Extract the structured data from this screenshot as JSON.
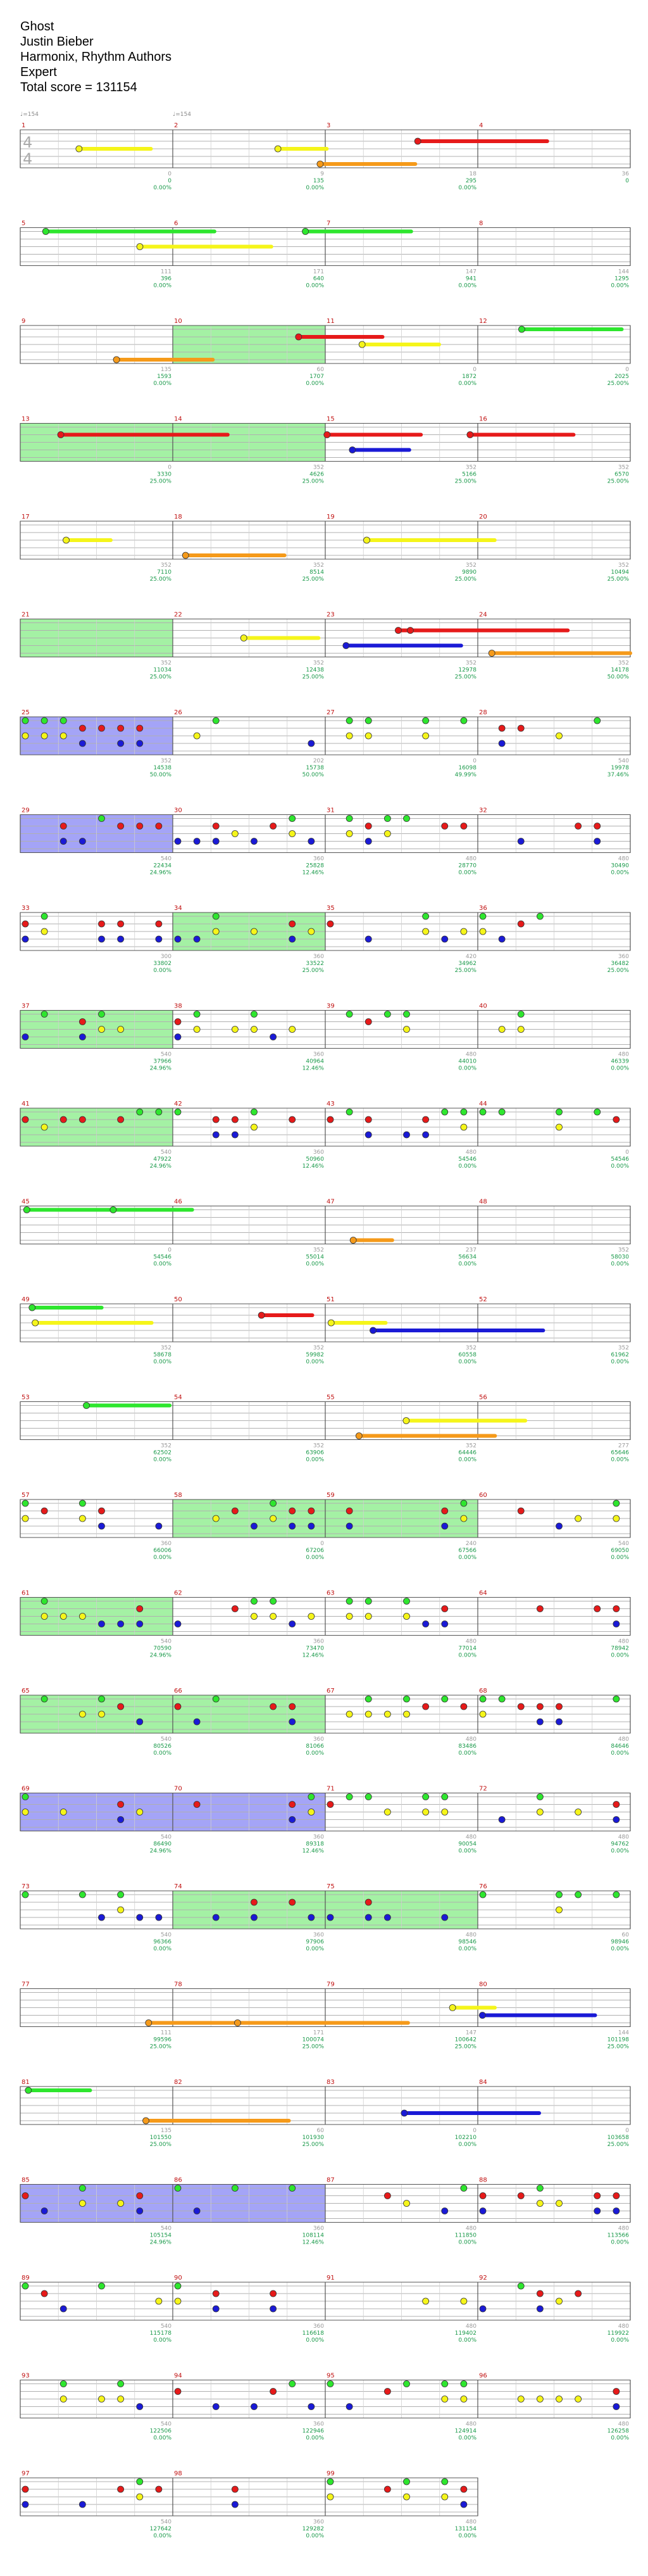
{
  "song": {
    "title": "Ghost",
    "artist": "Justin Bieber",
    "charter": "Harmonix, Rhythm Authors",
    "difficulty": "Expert",
    "total_score_label": "Total score = 131154"
  },
  "chart_data": {
    "type": "note-chart",
    "time_signature": {
      "numerator": "4",
      "denominator": "4"
    },
    "tempo_markers": [
      {
        "measure": 1,
        "label": "♩=154"
      },
      {
        "measure": 2,
        "label": "♩=154"
      }
    ],
    "lane_colors": {
      "green": "#2ee62e",
      "red": "#e61a1a",
      "yellow": "#f5f51a",
      "blue": "#1a1ad6",
      "orange": "#f59a1a"
    },
    "zone_colors": {
      "solo": "#5a5af0",
      "overdrive": "#5ae65a"
    },
    "score_color": "#1a9a4a",
    "count_color": "#9a9a9a",
    "rows": [
      {
        "measures": [
          1,
          2,
          3,
          4
        ],
        "blocks": [
          {
            "count": "0",
            "score": "0",
            "mult": "0.00%"
          },
          {
            "count": "9",
            "score": "135",
            "mult": "0.00%"
          },
          {
            "count": "18",
            "score": "295",
            "mult": "0.00%"
          },
          {
            "count": "36",
            "score": "0",
            "mult": ""
          }
        ]
      },
      {
        "measures": [
          5,
          6,
          7,
          8
        ],
        "blocks": [
          {
            "count": "111",
            "score": "396",
            "mult": "0.00%"
          },
          {
            "count": "171",
            "score": "640",
            "mult": "0.00%"
          },
          {
            "count": "147",
            "score": "941",
            "mult": "0.00%"
          },
          {
            "count": "144",
            "score": "1295",
            "mult": "0.00%"
          }
        ]
      },
      {
        "measures": [
          9,
          10,
          11,
          12
        ],
        "blocks": [
          {
            "count": "135",
            "score": "1593",
            "mult": "0.00%"
          },
          {
            "count": "60",
            "score": "1707",
            "mult": "0.00%"
          },
          {
            "count": "0",
            "score": "1872",
            "mult": "0.00%"
          },
          {
            "count": "0",
            "score": "2025",
            "mult": "25.00%"
          }
        ]
      },
      {
        "measures": [
          13,
          14,
          15,
          16
        ],
        "blocks": [
          {
            "count": "0",
            "score": "3330",
            "mult": "25.00%"
          },
          {
            "count": "352",
            "score": "4626",
            "mult": "25.00%"
          },
          {
            "count": "352",
            "score": "5166",
            "mult": "25.00%"
          },
          {
            "count": "352",
            "score": "6570",
            "mult": "25.00%"
          }
        ]
      },
      {
        "measures": [
          17,
          18,
          19,
          20
        ],
        "blocks": [
          {
            "count": "352",
            "score": "7110",
            "mult": "25.00%"
          },
          {
            "count": "352",
            "score": "8514",
            "mult": "25.00%"
          },
          {
            "count": "352",
            "score": "9890",
            "mult": "25.00%"
          },
          {
            "count": "352",
            "score": "10494",
            "mult": "25.00%"
          }
        ]
      },
      {
        "measures": [
          21,
          22,
          23,
          24
        ],
        "blocks": [
          {
            "count": "352",
            "score": "11034",
            "mult": "25.00%"
          },
          {
            "count": "352",
            "score": "12438",
            "mult": "25.00%"
          },
          {
            "count": "352",
            "score": "12978",
            "mult": "25.00%"
          },
          {
            "count": "352",
            "score": "14178",
            "mult": "50.00%"
          }
        ]
      },
      {
        "measures": [
          25,
          26,
          27,
          28
        ],
        "blocks": [
          {
            "count": "352",
            "score": "14538",
            "mult": "50.00%"
          },
          {
            "count": "202",
            "score": "15738",
            "mult": "50.00%"
          },
          {
            "count": "0",
            "score": "16098",
            "mult": "49.99%"
          },
          {
            "count": "540",
            "score": "19978",
            "mult": "37.46%"
          }
        ]
      },
      {
        "measures": [
          29,
          30,
          31,
          32
        ],
        "blocks": [
          {
            "count": "540",
            "score": "22434",
            "mult": "24.96%"
          },
          {
            "count": "360",
            "score": "25828",
            "mult": "12.46%"
          },
          {
            "count": "480",
            "score": "28770",
            "mult": "0.00%"
          },
          {
            "count": "480",
            "score": "30490",
            "mult": "0.00%"
          }
        ]
      },
      {
        "measures": [
          33,
          34,
          35,
          36
        ],
        "blocks": [
          {
            "count": "300",
            "score": "33802",
            "mult": "0.00%"
          },
          {
            "count": "360",
            "score": "33522",
            "mult": "25.00%"
          },
          {
            "count": "420",
            "score": "34962",
            "mult": "25.00%"
          },
          {
            "count": "360",
            "score": "36482",
            "mult": "25.00%"
          }
        ]
      },
      {
        "measures": [
          37,
          38,
          39,
          40
        ],
        "blocks": [
          {
            "count": "540",
            "score": "37966",
            "mult": "24.96%"
          },
          {
            "count": "360",
            "score": "40964",
            "mult": "12.46%"
          },
          {
            "count": "480",
            "score": "44010",
            "mult": "0.00%"
          },
          {
            "count": "480",
            "score": "46339",
            "mult": "0.00%"
          }
        ]
      },
      {
        "measures": [
          41,
          42,
          43,
          44
        ],
        "blocks": [
          {
            "count": "540",
            "score": "47922",
            "mult": "24.96%"
          },
          {
            "count": "360",
            "score": "50960",
            "mult": "12.46%"
          },
          {
            "count": "480",
            "score": "54546",
            "mult": "0.00%"
          },
          {
            "count": "0",
            "score": "54546",
            "mult": "0.00%"
          }
        ]
      },
      {
        "measures": [
          45,
          46,
          47,
          48
        ],
        "blocks": [
          {
            "count": "0",
            "score": "54546",
            "mult": "0.00%"
          },
          {
            "count": "352",
            "score": "55014",
            "mult": "0.00%"
          },
          {
            "count": "237",
            "score": "56634",
            "mult": "0.00%"
          },
          {
            "count": "352",
            "score": "58030",
            "mult": "0.00%"
          }
        ]
      },
      {
        "measures": [
          49,
          50,
          51,
          52
        ],
        "blocks": [
          {
            "count": "352",
            "score": "58678",
            "mult": "0.00%"
          },
          {
            "count": "352",
            "score": "59982",
            "mult": "0.00%"
          },
          {
            "count": "352",
            "score": "60558",
            "mult": "0.00%"
          },
          {
            "count": "352",
            "score": "61962",
            "mult": "0.00%"
          }
        ]
      },
      {
        "measures": [
          53,
          54,
          55,
          56
        ],
        "blocks": [
          {
            "count": "352",
            "score": "62502",
            "mult": "0.00%"
          },
          {
            "count": "352",
            "score": "63906",
            "mult": "0.00%"
          },
          {
            "count": "352",
            "score": "64446",
            "mult": "0.00%"
          },
          {
            "count": "277",
            "score": "65646",
            "mult": "0.00%"
          }
        ]
      },
      {
        "measures": [
          57,
          58,
          59,
          60
        ],
        "blocks": [
          {
            "count": "360",
            "score": "66006",
            "mult": "0.00%"
          },
          {
            "count": "0",
            "score": "67206",
            "mult": "0.00%"
          },
          {
            "count": "240",
            "score": "67566",
            "mult": "0.00%"
          },
          {
            "count": "540",
            "score": "69050",
            "mult": "0.00%"
          }
        ]
      },
      {
        "measures": [
          61,
          62,
          63,
          64
        ],
        "blocks": [
          {
            "count": "540",
            "score": "70590",
            "mult": "24.96%"
          },
          {
            "count": "360",
            "score": "73470",
            "mult": "12.46%"
          },
          {
            "count": "480",
            "score": "77014",
            "mult": "0.00%"
          },
          {
            "count": "480",
            "score": "78942",
            "mult": "0.00%"
          }
        ]
      },
      {
        "measures": [
          65,
          66,
          67,
          68
        ],
        "blocks": [
          {
            "count": "540",
            "score": "80526",
            "mult": "0.00%"
          },
          {
            "count": "360",
            "score": "81066",
            "mult": "0.00%"
          },
          {
            "count": "480",
            "score": "83486",
            "mult": "0.00%"
          },
          {
            "count": "480",
            "score": "84646",
            "mult": "0.00%"
          }
        ]
      },
      {
        "measures": [
          69,
          70,
          71,
          72
        ],
        "blocks": [
          {
            "count": "540",
            "score": "86490",
            "mult": "24.96%"
          },
          {
            "count": "360",
            "score": "89318",
            "mult": "12.46%"
          },
          {
            "count": "480",
            "score": "90054",
            "mult": "0.00%"
          },
          {
            "count": "480",
            "score": "94762",
            "mult": "0.00%"
          }
        ]
      },
      {
        "measures": [
          73,
          74,
          75,
          76
        ],
        "blocks": [
          {
            "count": "540",
            "score": "96366",
            "mult": "0.00%"
          },
          {
            "count": "360",
            "score": "97906",
            "mult": "0.00%"
          },
          {
            "count": "480",
            "score": "98546",
            "mult": "0.00%"
          },
          {
            "count": "60",
            "score": "98946",
            "mult": "0.00%"
          }
        ]
      },
      {
        "measures": [
          77,
          78,
          79,
          80
        ],
        "blocks": [
          {
            "count": "111",
            "score": "99596",
            "mult": "25.00%"
          },
          {
            "count": "171",
            "score": "100074",
            "mult": "25.00%"
          },
          {
            "count": "147",
            "score": "100642",
            "mult": "25.00%"
          },
          {
            "count": "144",
            "score": "101198",
            "mult": "25.00%"
          }
        ]
      },
      {
        "measures": [
          81,
          82,
          83,
          84
        ],
        "blocks": [
          {
            "count": "135",
            "score": "101550",
            "mult": "25.00%"
          },
          {
            "count": "60",
            "score": "101930",
            "mult": "25.00%"
          },
          {
            "count": "0",
            "score": "102210",
            "mult": "0.00%"
          },
          {
            "count": "0",
            "score": "103658",
            "mult": "25.00%"
          }
        ]
      },
      {
        "measures": [
          85,
          86,
          87,
          88
        ],
        "blocks": [
          {
            "count": "540",
            "score": "105154",
            "mult": "24.96%"
          },
          {
            "count": "360",
            "score": "108114",
            "mult": "12.46%"
          },
          {
            "count": "480",
            "score": "111850",
            "mult": "0.00%"
          },
          {
            "count": "480",
            "score": "113566",
            "mult": "0.00%"
          }
        ]
      },
      {
        "measures": [
          89,
          90,
          91,
          92
        ],
        "blocks": [
          {
            "count": "540",
            "score": "115178",
            "mult": "0.00%"
          },
          {
            "count": "360",
            "score": "116618",
            "mult": "0.00%"
          },
          {
            "count": "480",
            "score": "119402",
            "mult": "0.00%"
          },
          {
            "count": "480",
            "score": "119922",
            "mult": "0.00%"
          }
        ]
      },
      {
        "measures": [
          93,
          94,
          95,
          96
        ],
        "blocks": [
          {
            "count": "540",
            "score": "122506",
            "mult": "0.00%"
          },
          {
            "count": "360",
            "score": "122946",
            "mult": "0.00%"
          },
          {
            "count": "480",
            "score": "124914",
            "mult": "0.00%"
          },
          {
            "count": "480",
            "score": "126258",
            "mult": "0.00%"
          }
        ]
      },
      {
        "measures": [
          97,
          98,
          99
        ],
        "blocks": [
          {
            "count": "540",
            "score": "127642",
            "mult": "0.00%"
          },
          {
            "count": "360",
            "score": "129282",
            "mult": "0.00%"
          },
          {
            "count": "480",
            "score": "131154",
            "mult": "0.00%"
          }
        ]
      }
    ]
  }
}
